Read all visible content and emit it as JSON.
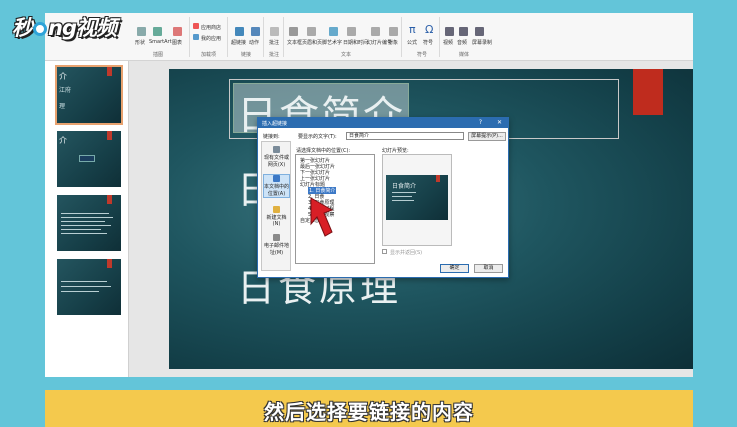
{
  "watermark": {
    "part1": "秒",
    "part2": "ng视频"
  },
  "ribbon": {
    "items": [
      "形状",
      "SmartArt",
      "图表",
      "应用商店",
      "我的应用",
      "超链接",
      "动作",
      "批注",
      "文本框",
      "页眉和页脚",
      "艺术字",
      "日期和时间",
      "幻灯片编号",
      "对象",
      "公式",
      "符号",
      "视频",
      "音频",
      "屏幕录制"
    ],
    "groups": [
      "插图",
      "加载项",
      "链接",
      "批注",
      "文本",
      "符号",
      "媒体"
    ]
  },
  "thumbnails": [
    {
      "title": "介",
      "line1": "江府",
      "line2": "理"
    },
    {
      "title": "介"
    },
    {
      "title": ""
    },
    {
      "title": ""
    }
  ],
  "slide": {
    "title": "日食简介",
    "line2": "日",
    "line3": "日食原理"
  },
  "dialog": {
    "title": "插入超链接",
    "help": "?",
    "close": "✕",
    "link_to_label": "链接到:",
    "display_text_label": "要显示的文字(T):",
    "display_text_value": "日食简介",
    "screen_tip_button": "屏幕提示(P)...",
    "select_place_label": "请选择文档中的位置(C):",
    "preview_label": "幻灯片预览:",
    "show_return_label": "显示并返回(S)",
    "ok": "确定",
    "cancel": "取消",
    "link_options": [
      {
        "label": "现有文件或网页(X)"
      },
      {
        "label": "本文档中的位置(A)"
      },
      {
        "label": "新建文档(N)"
      },
      {
        "label": "电子邮件地址(M)"
      }
    ],
    "tree": [
      "第一张幻灯片",
      "最后一张幻灯片",
      "下一张幻灯片",
      "上一张幻灯片",
      "幻灯片标题",
      "1. 日食简介",
      "2. 日食",
      "3. 日食原理",
      "4. 日食过程",
      "5. 日食观察",
      "自定义放映"
    ],
    "preview_title": "日食简介"
  },
  "subtitle": "然后选择要链接的内容"
}
